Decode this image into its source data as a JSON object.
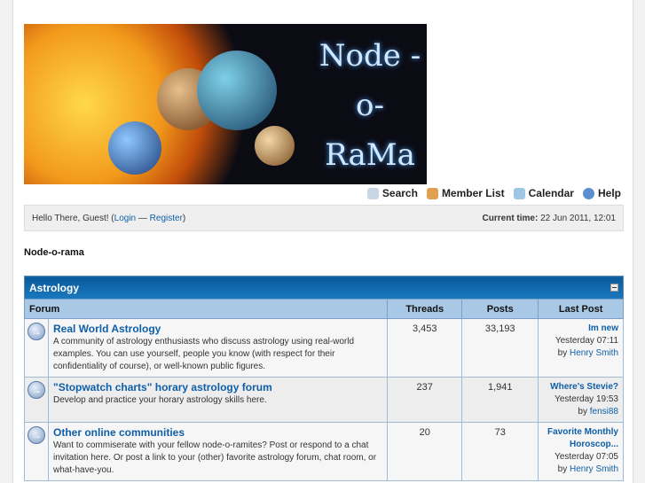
{
  "logo": {
    "text": "Node -o- RaMa"
  },
  "menu": [
    {
      "label": "Search",
      "icon": "search-icon"
    },
    {
      "label": "Member List",
      "icon": "members-icon"
    },
    {
      "label": "Calendar",
      "icon": "calendar-icon"
    },
    {
      "label": "Help",
      "icon": "help-icon"
    }
  ],
  "welcome": {
    "greeting": "Hello There, Guest! (",
    "login": "Login",
    "sep": " — ",
    "register": "Register",
    "close": ")",
    "time_label": "Current time:",
    "time_value": " 22 Jun 2011, 12:01"
  },
  "page_title": "Node-o-rama",
  "category": {
    "title": "Astrology",
    "columns": [
      "Forum",
      "Threads",
      "Posts",
      "Last Post"
    ],
    "forums": [
      {
        "title": "Real World Astrology",
        "desc": "A community of astrology enthusiasts who discuss astrology using real-world examples. You can use yourself, people you know (with respect for their confidentiality of course), or well-known public figures.",
        "threads": "3,453",
        "posts": "33,193",
        "last_title": "Im new",
        "last_time": "Yesterday 07:11",
        "by": "by ",
        "last_user": "Henry Smith"
      },
      {
        "title": "\"Stopwatch charts\" horary astrology forum",
        "desc": "Develop and practice your horary astrology skills here.",
        "threads": "237",
        "posts": "1,941",
        "last_title": "Where's Stevie?",
        "last_time": "Yesterday 19:53",
        "by": "by ",
        "last_user": "fensi88"
      },
      {
        "title": "Other online communities",
        "desc": "Want to commiserate with your fellow node-o-ramites? Post or respond to a chat invitation here. Or post a link to your (other) favorite astrology forum, chat room, or what-have-you.",
        "threads": "20",
        "posts": "73",
        "last_title": "Favorite Monthly Horoscop...",
        "last_time": "Yesterday 07:05",
        "by": "by ",
        "last_user": "Henry Smith"
      }
    ]
  }
}
